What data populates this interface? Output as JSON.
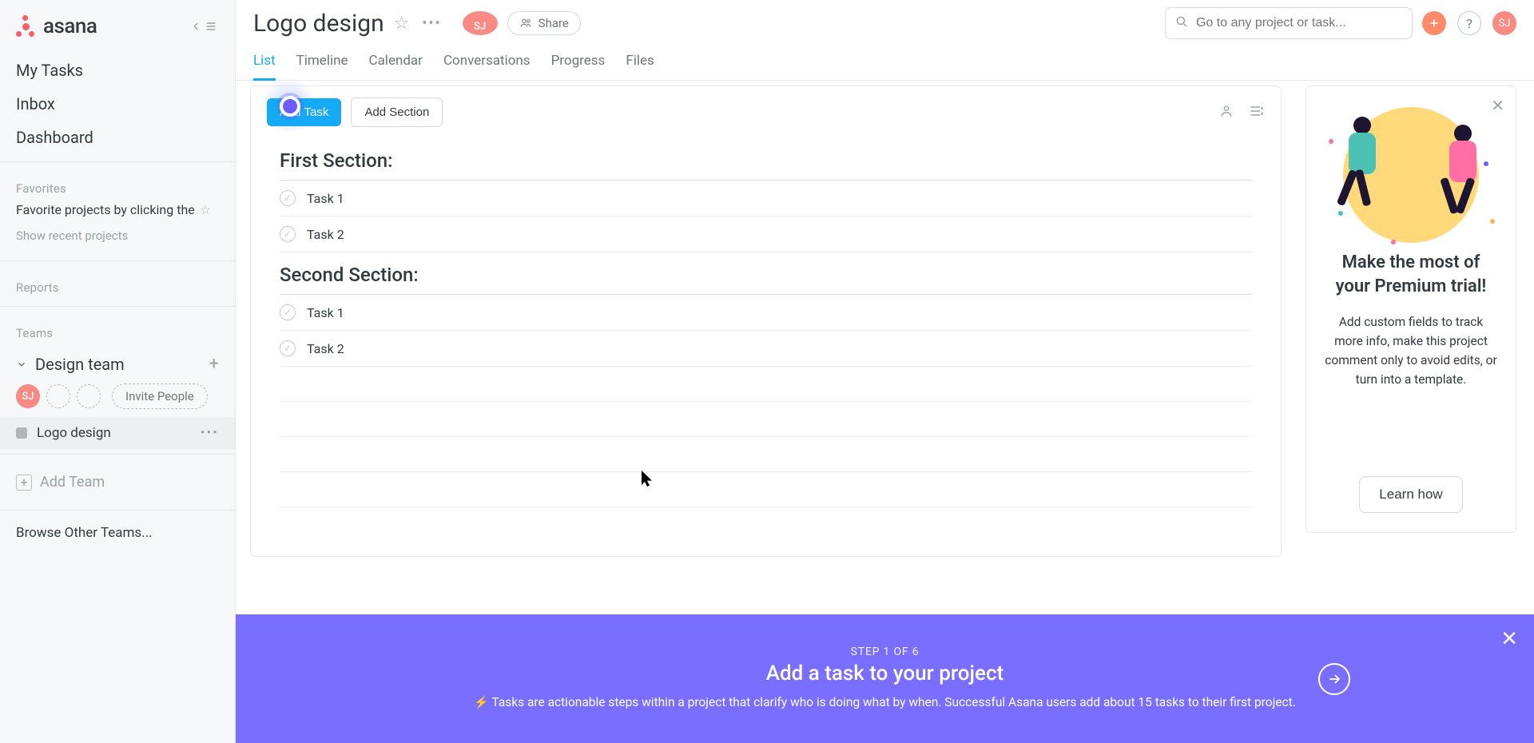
{
  "app": {
    "name": "asana",
    "user_initials": "SJ"
  },
  "sidebar": {
    "nav": {
      "my_tasks": "My Tasks",
      "inbox": "Inbox",
      "dashboard": "Dashboard"
    },
    "favorites_label": "Favorites",
    "favorites_hint": "Favorite projects by clicking the",
    "show_recent": "Show recent projects",
    "reports_label": "Reports",
    "teams_label": "Teams",
    "team": {
      "name": "Design team",
      "invite_label": "Invite People"
    },
    "project": {
      "name": "Logo design"
    },
    "add_team": "Add Team",
    "browse_teams": "Browse Other Teams..."
  },
  "header": {
    "title": "Logo design",
    "share": "Share",
    "search_placeholder": "Go to any project or task...",
    "tabs": [
      "List",
      "Timeline",
      "Calendar",
      "Conversations",
      "Progress",
      "Files"
    ],
    "active_tab": 0
  },
  "panel": {
    "add_task": "Add Task",
    "add_section": "Add Section",
    "sections": [
      {
        "title": "First Section:",
        "tasks": [
          "Task 1",
          "Task 2"
        ]
      },
      {
        "title": "Second Section:",
        "tasks": [
          "Task 1",
          "Task 2"
        ]
      }
    ]
  },
  "promo": {
    "heading": "Make the most of your Premium trial!",
    "body": "Add custom fields to track more info, make this project comment only to avoid edits, or turn into a template.",
    "cta": "Learn how"
  },
  "banner": {
    "step": "STEP 1 OF 6",
    "title": "Add a task to your project",
    "body_prefix": "⚡",
    "body": "Tasks are actionable steps within a project that clarify who is doing what by when. Successful Asana users add about 15 tasks to their first project."
  },
  "colors": {
    "accent_blue": "#14aaf5",
    "accent_purple": "#796eff",
    "accent_orange": "#fd8b68",
    "avatar": "#fa8a84"
  }
}
